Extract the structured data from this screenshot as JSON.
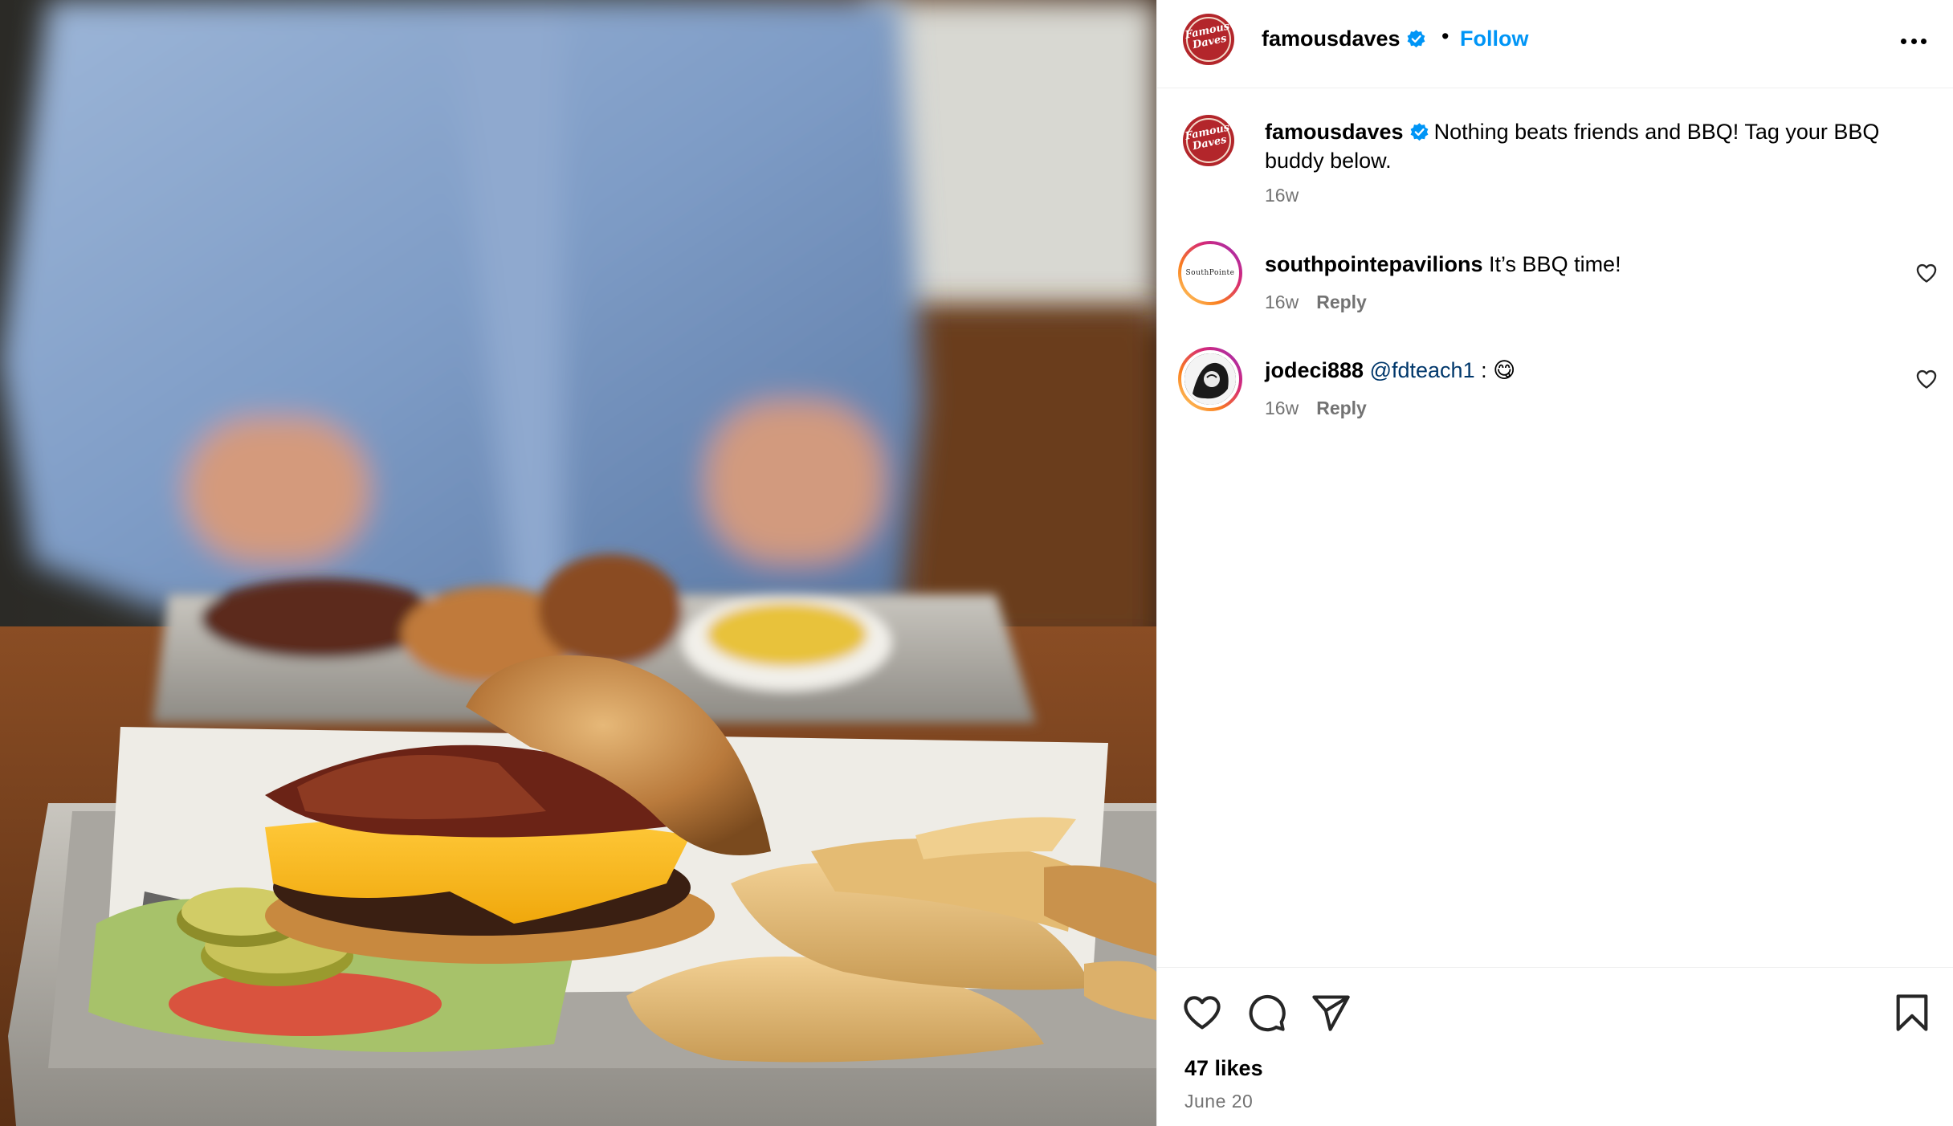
{
  "post": {
    "author": "famousdaves",
    "follow_label": "Follow",
    "separator": "•",
    "brand_logo_text": "Famous Daves"
  },
  "caption": {
    "username": "famousdaves",
    "text": "Nothing beats friends and BBQ! Tag your BBQ buddy below.",
    "age": "16w"
  },
  "comments": [
    {
      "username": "southpointepavilions",
      "text": "It’s BBQ time!",
      "age": "16w",
      "reply_label": "Reply",
      "avatar_text": "SouthPointe"
    },
    {
      "username": "jodeci888",
      "mention": "@fdteach1",
      "text": " : 😋",
      "age": "16w",
      "reply_label": "Reply"
    }
  ],
  "footer": {
    "likes": "47 likes",
    "date": "June 20"
  },
  "icons": {
    "more": "more-options-icon",
    "verified": "verified-badge-icon",
    "like": "heart-icon",
    "comment": "comment-bubble-icon",
    "share": "paper-plane-icon",
    "save": "bookmark-icon"
  },
  "colors": {
    "follow_blue": "#0095f6",
    "mention_blue": "#00376b",
    "muted_text": "#737373",
    "brand_red": "#b3262b"
  }
}
